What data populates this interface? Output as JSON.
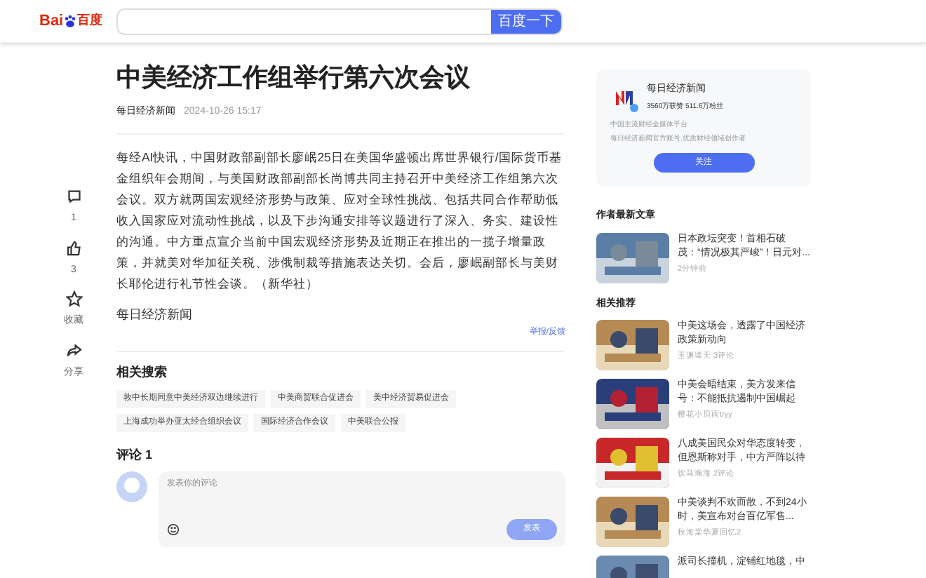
{
  "header": {
    "logo_latin": "Bai",
    "logo_cjk": "百度",
    "search_button": "百度一下"
  },
  "article": {
    "title": "中美经济工作组举行第六次会议",
    "source": "每日经济新闻",
    "time": "2024-10-26 15:17",
    "body": "每经AI快讯，中国财政部副部长廖岷25日在美国华盛顿出席世界银行/国际货币基金组织年会期间，与美国财政部副部长尚博共同主持召开中美经济工作组第六次会议。双方就两国宏观经济形势与政策、应对全球性挑战、包括共同合作帮助低收入国家应对流动性挑战，以及下步沟通安排等议题进行了深入、务实、建设性的沟通。中方重点宣介当前中国宏观经济形势及近期正在推出的一揽子增量政策，并就美对华加征关税、涉俄制裁等措施表达关切。会后，廖岷副部长与美财长耶伦进行礼节性会谈。（新华社）",
    "footer_source": "每日经济新闻",
    "report": "举报/反馈"
  },
  "actions": [
    {
      "kind": "comment",
      "label": "1"
    },
    {
      "kind": "like",
      "label": "3"
    },
    {
      "kind": "star",
      "label": "收藏"
    },
    {
      "kind": "share",
      "label": "分享"
    }
  ],
  "related_search": {
    "title": "相关搜索",
    "tags": [
      "敦中长期同意中美经济双边继续进行",
      "中美商贸联合促进会",
      "美中经济贸易促进会",
      "上海成功举办亚太经合组织会议",
      "国际经济合作会议",
      "中美联合公报"
    ]
  },
  "comments": {
    "title": "评论 1",
    "placeholder": "发表你的评论",
    "send": "发表"
  },
  "author_card": {
    "name": "每日经济新闻",
    "stats": "3560万获赞 511.6万粉丝",
    "line1": "中国主流财经全媒体平台",
    "line2": "每日经济新闻官方账号,优质财经领域创作者",
    "follow": "关注"
  },
  "latest": {
    "title": "作者最新文章",
    "items": [
      {
        "title": "日本政坛突变！首相石破茂：“情况极其严峻”！日元对...",
        "meta": "2分钟前"
      }
    ]
  },
  "recommend": {
    "title": "相关推荐",
    "items": [
      {
        "title": "中美这场会，透露了中国经济政策新动向",
        "meta": "玉渊谭天 3评论"
      },
      {
        "title": "中美会晤结束，美方发来信号：不能抵抗遏制中国崛起",
        "meta": "樱花小贝雨tryy"
      },
      {
        "title": "八成美国民众对华态度转变，但恩斯称对手，中方严阵以待",
        "meta": "饮马瀚海 2评论"
      },
      {
        "title": "中美谈判不欢而散，不到24小时，美宣布对台百亿军售...",
        "meta": "秋海棠华夏回忆2"
      },
      {
        "title": "派司长撞机，淀铺红地毯，中"
      }
    ]
  }
}
